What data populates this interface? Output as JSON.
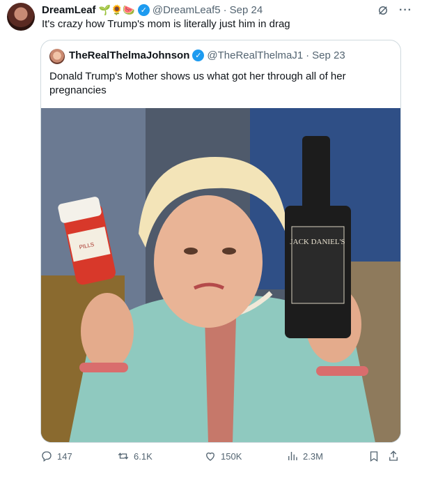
{
  "tweet": {
    "author_name": "DreamLeaf",
    "emojis": "🌱🌻🍉",
    "handle": "@DreamLeaf5",
    "separator": "·",
    "date": "Sep 24",
    "text": "It's crazy how Trump's mom is literally just him in drag"
  },
  "quoted": {
    "author_name": "TheRealThelmaJohnson",
    "handle": "@TheRealThelmaJ1",
    "separator": "·",
    "date": "Sep 23",
    "text": "Donald Trump's Mother shows us what got her through all of her pregnancies"
  },
  "photo": {
    "bottle_label": "JACK DANIEL'S",
    "pill_label": "PILLS"
  },
  "actions": {
    "replies": "147",
    "retweets": "6.1K",
    "likes": "150K",
    "views": "2.3M"
  },
  "icons": {
    "verified": "verified-check-icon",
    "grok": "grok-icon",
    "more": "more-icon",
    "reply": "reply-icon",
    "retweet": "retweet-icon",
    "like": "heart-icon",
    "views": "views-icon",
    "bookmark": "bookmark-icon",
    "share": "share-icon"
  },
  "colors": {
    "accent": "#1d9bf0",
    "secondary_text": "#536471",
    "border": "#cfd9de"
  }
}
